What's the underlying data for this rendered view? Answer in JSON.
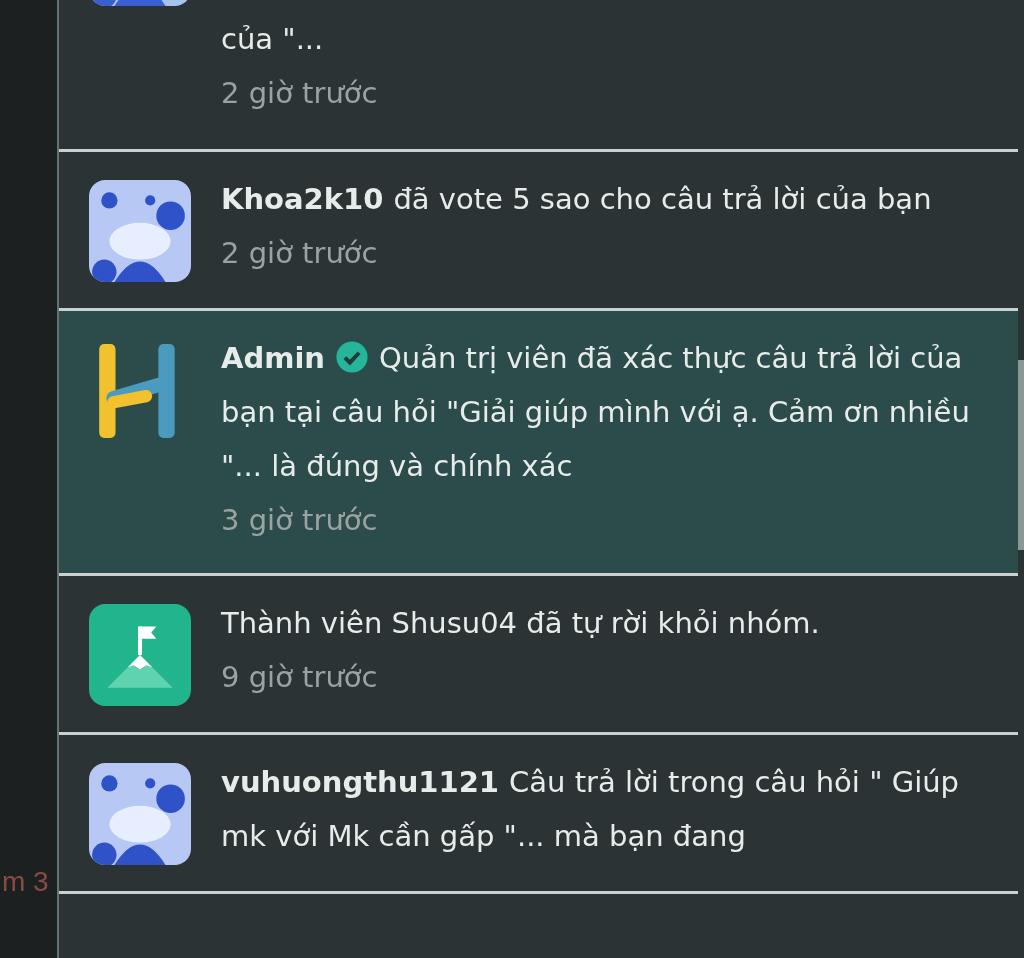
{
  "background_fragment": "m 3",
  "notifications": [
    {
      "message": "của  \"...",
      "time": "2 giờ trước",
      "verified": false,
      "highlighted": false
    },
    {
      "user": "Khoa2k10",
      "verified": false,
      "message": "đã vote 5 sao cho câu trả lời của bạn",
      "time": "2 giờ trước",
      "highlighted": false
    },
    {
      "avatar": {
        "kind": "brand"
      },
      "user": "Admin",
      "verified": true,
      "message": "Quản trị viên đã xác thực câu trả lời của bạn tại câu hỏi \"Giải giúp mình với ạ. Cảm ơn nhiều \"... là đúng và chính xác",
      "time": "3 giờ trước",
      "highlighted": true
    },
    {
      "avatar": {
        "kind": "group"
      },
      "verified": false,
      "message": " Thành viên Shusu04 đã tự rời khỏi nhóm.",
      "time": "9 giờ trước",
      "highlighted": false
    },
    {
      "user": "vuhuongthu1121",
      "verified": false,
      "message": "Câu trả lời trong câu hỏi \" Giúp mk với Mk cần gấp \"... mà bạn đang",
      "highlighted": false
    }
  ]
}
